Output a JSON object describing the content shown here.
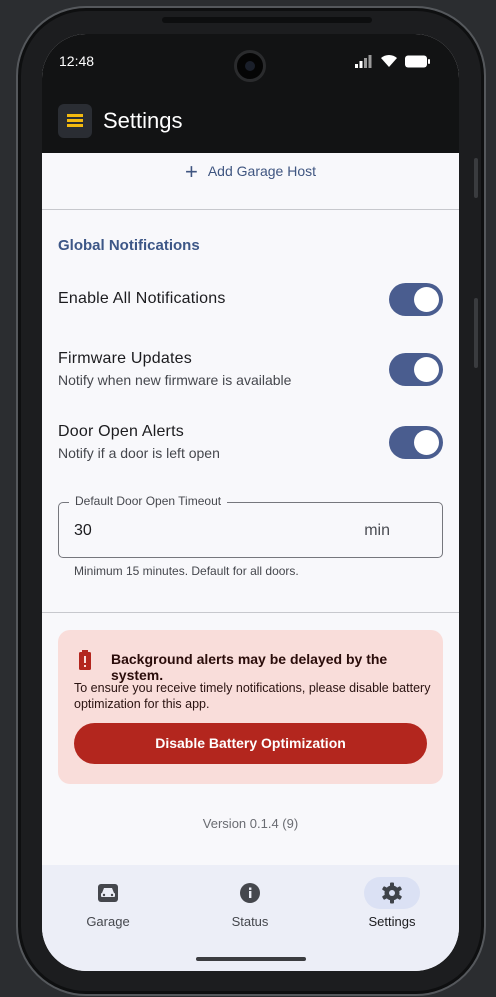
{
  "status_bar": {
    "time": "12:48"
  },
  "app_bar": {
    "title": "Settings"
  },
  "hosts": {
    "add_label": "Add Garage Host"
  },
  "notifications": {
    "section_title": "Global Notifications",
    "enable_all": {
      "label": "Enable All Notifications",
      "on": true
    },
    "firmware": {
      "label": "Firmware Updates",
      "sublabel": "Notify when new firmware is available",
      "on": true
    },
    "door_open": {
      "label": "Door Open Alerts",
      "sublabel": "Notify if a door is left open",
      "on": true
    },
    "timeout": {
      "legend": "Default Door Open Timeout",
      "value": "30",
      "suffix": "min",
      "helper": "Minimum 15 minutes. Default for all doors."
    }
  },
  "battery_warning": {
    "title": "Background alerts may be delayed by the system.",
    "text": "To ensure you receive timely notifications, please disable battery optimization for this app.",
    "button": "Disable Battery Optimization",
    "color": "#b3261e"
  },
  "version": "Version 0.1.4 (9)",
  "nav": {
    "items": [
      {
        "label": "Garage",
        "icon": "car-icon"
      },
      {
        "label": "Status",
        "icon": "info-icon"
      },
      {
        "label": "Settings",
        "icon": "gear-icon",
        "active": true
      }
    ]
  },
  "colors": {
    "accent": "#4a5d8f",
    "section": "#3d5787",
    "nav_bg": "#eceef7"
  }
}
